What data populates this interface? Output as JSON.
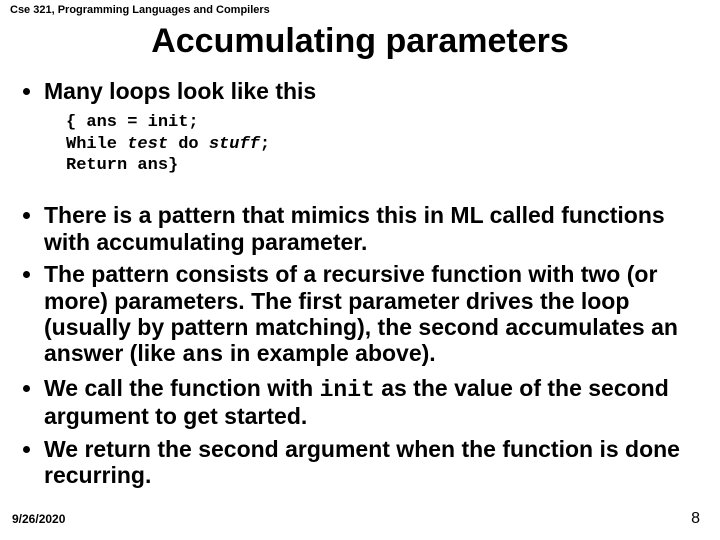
{
  "course": "Cse 321, Programming Languages and Compilers",
  "title": "Accumulating parameters",
  "bullet1": "Many loops look like this",
  "code": {
    "l1a": "{ ans = init;",
    "l2a": "  While ",
    "l2b": "test",
    "l2c": " do ",
    "l2d": "stuff",
    "l2e": ";",
    "l3a": "  Return ans}"
  },
  "bullet2": "There is a pattern that mimics this in ML called functions with accumulating parameter.",
  "bullet3": {
    "a": "The pattern consists of a recursive function with two (or more) parameters. The first parameter drives the loop (usually by pattern matching), the second accumulates an answer (like ",
    "code": "ans",
    "b": " in example above)."
  },
  "bullet4": {
    "a": "We call the function with ",
    "code": "init",
    "b": " as the value of the second argument to get started."
  },
  "bullet5": "We return the second argument when the function is done recurring.",
  "footer_date": "9/26/2020",
  "footer_page": "8"
}
